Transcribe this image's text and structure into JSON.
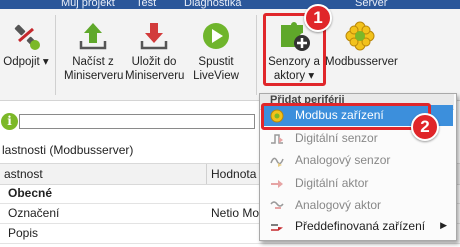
{
  "tabs": [
    "Můj projekt",
    "Test",
    "Diagnostika",
    "Server"
  ],
  "ribbon": {
    "buttons": [
      {
        "label": "Odpojit ▾"
      },
      {
        "label": "Načíst z Miniserveru"
      },
      {
        "label": "Uložit do Miniserveru"
      },
      {
        "label": "Spustit LiveView"
      },
      {
        "label": "Senzory a aktory ▾"
      },
      {
        "label": "Modbusserver"
      }
    ]
  },
  "badges": {
    "one": "1",
    "two": "2"
  },
  "properties": {
    "title": "lastnosti (Modbusserver)",
    "col_name": "astnost",
    "col_value": "Hodnota",
    "rows": [
      {
        "name": "Obecné",
        "value": "",
        "section": true
      },
      {
        "name": "Označení",
        "value": "Netio Mod",
        "section": false
      },
      {
        "name": "Popis",
        "value": "",
        "section": false
      }
    ]
  },
  "menu": {
    "header": "Přidat periférii",
    "items": [
      {
        "label": "Modbus zařízení",
        "icon": "modbus-gear-icon",
        "state": "selected"
      },
      {
        "label": "Digitální senzor",
        "icon": "digital-sensor-icon",
        "state": "disabled"
      },
      {
        "label": "Analogový senzor",
        "icon": "analog-sensor-icon",
        "state": "disabled"
      },
      {
        "label": "Digitální aktor",
        "icon": "digital-actor-icon",
        "state": "disabled"
      },
      {
        "label": "Analogový aktor",
        "icon": "analog-actor-icon",
        "state": "disabled"
      },
      {
        "label": "Předdefinovaná zařízení",
        "icon": "predefined-device-icon",
        "state": "normal",
        "submenu": true
      }
    ]
  },
  "colors": {
    "accent": "#e0262a",
    "selection": "#3c8fdc",
    "ribbon_bg": "#f3f3f3"
  }
}
